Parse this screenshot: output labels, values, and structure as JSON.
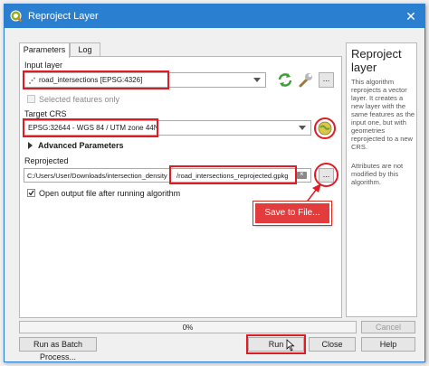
{
  "window": {
    "title": "Reproject Layer",
    "close_glyph": "✕",
    "app_icon": "qgis-logo-icon"
  },
  "tabs": [
    {
      "label": "Parameters"
    },
    {
      "label": "Log"
    }
  ],
  "input_layer": {
    "label": "Input layer",
    "value": "road_intersections [EPSG:4326]",
    "selected_only_label": "Selected features only",
    "selected_only_checked": false,
    "browse_label": "..."
  },
  "target_crs": {
    "label": "Target CRS",
    "value": "EPSG:32644 - WGS 84 / UTM zone 44N"
  },
  "advanced": {
    "label": "Advanced Parameters",
    "expanded": false
  },
  "reprojected": {
    "label": "Reprojected",
    "path_prefix": "C:/Users/User/Downloads/intersection_density",
    "path_file": "/road_intersections_reprojected.gpkg",
    "browse_label": "...",
    "open_after_label": "Open output file after running algorithm",
    "open_after_checked": true
  },
  "callout": {
    "text": "Save to File..."
  },
  "help": {
    "title": "Reproject layer",
    "para1": "This algorithm reprojects a vector layer. It creates a new layer with the same features as the input one, but with geometries reprojected to a new CRS.",
    "para2": "Attributes are not modified by this algorithm."
  },
  "progress": {
    "text": "0%",
    "value": 0
  },
  "buttons": {
    "batch": "Run as Batch Process...",
    "cancel": "Cancel",
    "run": "Run",
    "close": "Close",
    "help": "Help"
  },
  "colors": {
    "accent": "#2b7fd0",
    "annotation": "#e01b24"
  }
}
